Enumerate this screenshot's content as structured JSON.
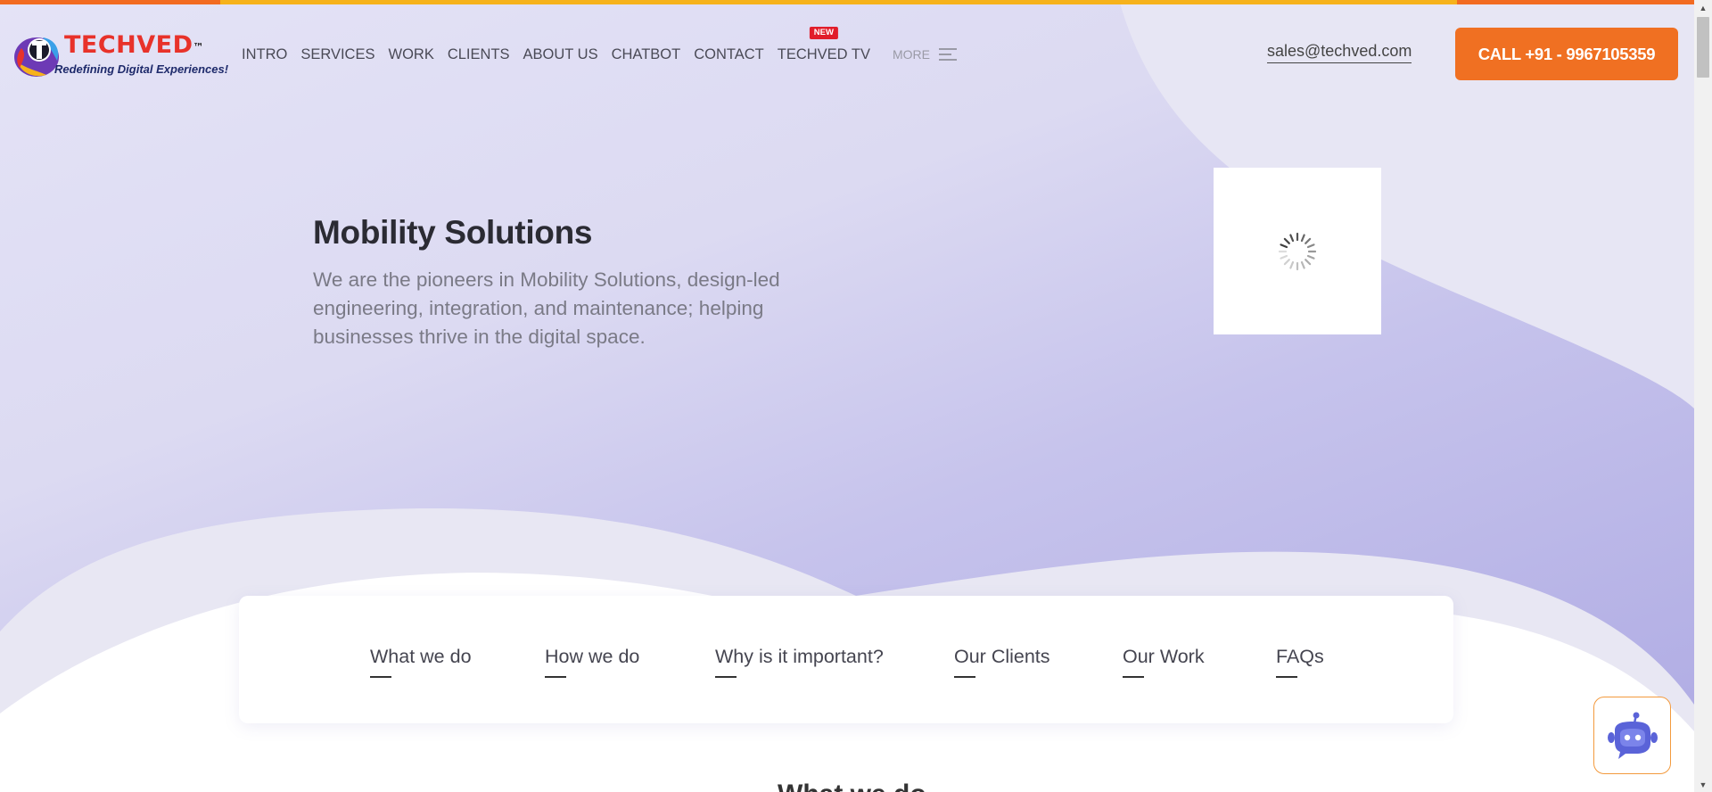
{
  "brand": {
    "name": "TECHVED",
    "trademark": "™",
    "tagline": "Redefining Digital Experiences!"
  },
  "nav": {
    "items": [
      {
        "label": "INTRO"
      },
      {
        "label": "SERVICES"
      },
      {
        "label": "WORK"
      },
      {
        "label": "CLIENTS"
      },
      {
        "label": "ABOUT US"
      },
      {
        "label": "CHATBOT"
      },
      {
        "label": "CONTACT"
      },
      {
        "label": "TECHVED TV",
        "badge": "NEW"
      }
    ],
    "more_label": "MORE"
  },
  "contact": {
    "email": "sales@techved.com",
    "call_label": "CALL +91 - 9967105359"
  },
  "hero": {
    "title": "Mobility Solutions",
    "description": "We are the pioneers in Mobility Solutions, design-led engineering, integration, and maintenance; helping businesses thrive in the digital space."
  },
  "tabs": [
    {
      "label": "What we do"
    },
    {
      "label": "How we do"
    },
    {
      "label": "Why is it important?"
    },
    {
      "label": "Our Clients"
    },
    {
      "label": "Our Work"
    },
    {
      "label": "FAQs"
    }
  ],
  "next_section": {
    "heading": "What we do"
  },
  "icons": {
    "loading": "spinner-icon",
    "menu": "hamburger-icon",
    "chatbot": "chatbot-robot-icon",
    "scroll_up": "arrow-up-icon",
    "scroll_down": "arrow-down-icon"
  },
  "colors": {
    "accent": "#f07022",
    "top_strip_orange": "#f26b21",
    "top_strip_yellow": "#f6b21b",
    "badge_red": "#e11d2a",
    "hero_gradient_light": "#e4e3f6",
    "hero_gradient_dark": "#aeaae3",
    "logo_red": "#e8322a",
    "tagline_navy": "#1e2a6b",
    "chatbot_blue": "#5a63d8"
  }
}
